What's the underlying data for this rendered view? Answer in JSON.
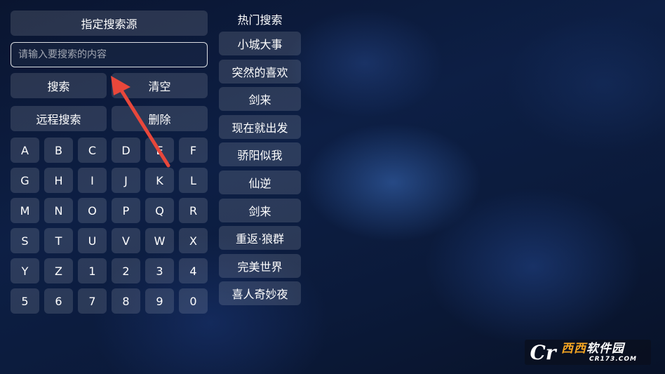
{
  "search_panel": {
    "source_button": "指定搜索源",
    "input_placeholder": "请输入要搜索的内容",
    "input_value": "",
    "search_button": "搜索",
    "clear_button": "清空",
    "remote_search_button": "远程搜索",
    "delete_button": "删除"
  },
  "keyboard": {
    "keys": [
      "A",
      "B",
      "C",
      "D",
      "E",
      "F",
      "G",
      "H",
      "I",
      "J",
      "K",
      "L",
      "M",
      "N",
      "O",
      "P",
      "Q",
      "R",
      "S",
      "T",
      "U",
      "V",
      "W",
      "X",
      "Y",
      "Z",
      "1",
      "2",
      "3",
      "4",
      "5",
      "6",
      "7",
      "8",
      "9",
      "0"
    ]
  },
  "hot_search": {
    "title": "热门搜索",
    "items": [
      "小城大事",
      "突然的喜欢",
      "剑来",
      "现在就出发",
      "骄阳似我",
      "仙逆",
      "剑来",
      "重返·狼群",
      "完美世界",
      "喜人奇妙夜"
    ]
  },
  "watermark": {
    "brand_a": "西西",
    "brand_b": "软件园",
    "domain": "CR173.COM"
  },
  "colors": {
    "button_bg": "rgba(255,255,255,0.13)",
    "arrow": "#e8473b",
    "watermark_orange": "#f5a623"
  }
}
